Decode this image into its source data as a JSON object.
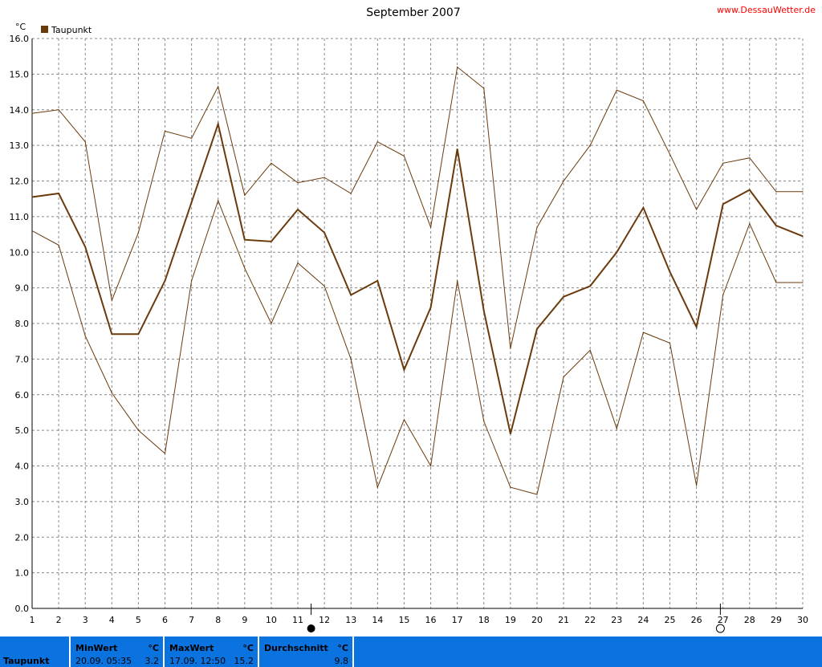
{
  "header": {
    "title": "September 2007",
    "site": "www.DessauWetter.de"
  },
  "colors": {
    "series": "#6b3a0c",
    "summary_bar": "#0a73e0",
    "site_link": "#ff0000"
  },
  "chart_data": {
    "type": "line",
    "title": "September 2007",
    "unit": "°C",
    "legend": "Taupunkt",
    "legend_position": "top-left",
    "grid": true,
    "ylim": [
      0,
      16
    ],
    "yticks": [
      "0.0",
      "1.0",
      "2.0",
      "3.0",
      "4.0",
      "5.0",
      "6.0",
      "7.0",
      "8.0",
      "9.0",
      "10.0",
      "11.0",
      "12.0",
      "13.0",
      "14.0",
      "15.0",
      "16.0"
    ],
    "x": [
      1,
      2,
      3,
      4,
      5,
      6,
      7,
      8,
      9,
      10,
      11,
      12,
      13,
      14,
      15,
      16,
      17,
      18,
      19,
      20,
      21,
      22,
      23,
      24,
      25,
      26,
      27,
      28,
      29,
      30
    ],
    "series": [
      {
        "role": "average",
        "name": "Taupunkt",
        "values": [
          11.55,
          11.65,
          10.15,
          7.7,
          7.7,
          9.2,
          11.4,
          13.6,
          10.35,
          10.3,
          11.2,
          10.55,
          8.8,
          9.2,
          6.7,
          8.45,
          12.9,
          8.35,
          4.9,
          7.85,
          8.75,
          9.05,
          10.0,
          11.25,
          9.45,
          7.9,
          11.35,
          11.75,
          10.75,
          10.45
        ]
      },
      {
        "role": "max",
        "values": [
          13.9,
          14.0,
          13.1,
          8.65,
          10.55,
          13.4,
          13.2,
          14.65,
          11.6,
          12.5,
          11.95,
          12.1,
          11.65,
          13.1,
          12.7,
          10.7,
          15.2,
          14.6,
          7.3,
          10.7,
          12.0,
          13.0,
          14.55,
          14.25,
          12.75,
          11.2,
          12.5,
          12.65,
          11.7,
          11.7
        ]
      },
      {
        "role": "min",
        "values": [
          10.6,
          10.2,
          7.65,
          6.05,
          5.0,
          4.35,
          9.2,
          11.45,
          9.55,
          8.0,
          9.7,
          9.05,
          7.0,
          3.4,
          5.3,
          4.0,
          9.2,
          5.25,
          3.4,
          3.2,
          6.5,
          7.25,
          5.05,
          7.75,
          7.45,
          3.45,
          8.8,
          10.8,
          9.15,
          9.15
        ]
      }
    ],
    "moon_markers": [
      {
        "day": 11.5,
        "phase": "new-moon"
      },
      {
        "day": 26.9,
        "phase": "full-moon"
      }
    ]
  },
  "summary": {
    "row_label": "Taupunkt",
    "min": {
      "label": "MinWert",
      "unit": "°C",
      "time": "20.09.  05:35",
      "value": "3.2"
    },
    "max": {
      "label": "MaxWert",
      "unit": "°C",
      "time": "17.09.  12:50",
      "value": "15.2"
    },
    "avg": {
      "label": "Durchschnitt",
      "unit": "°C",
      "value": "9.8"
    }
  }
}
